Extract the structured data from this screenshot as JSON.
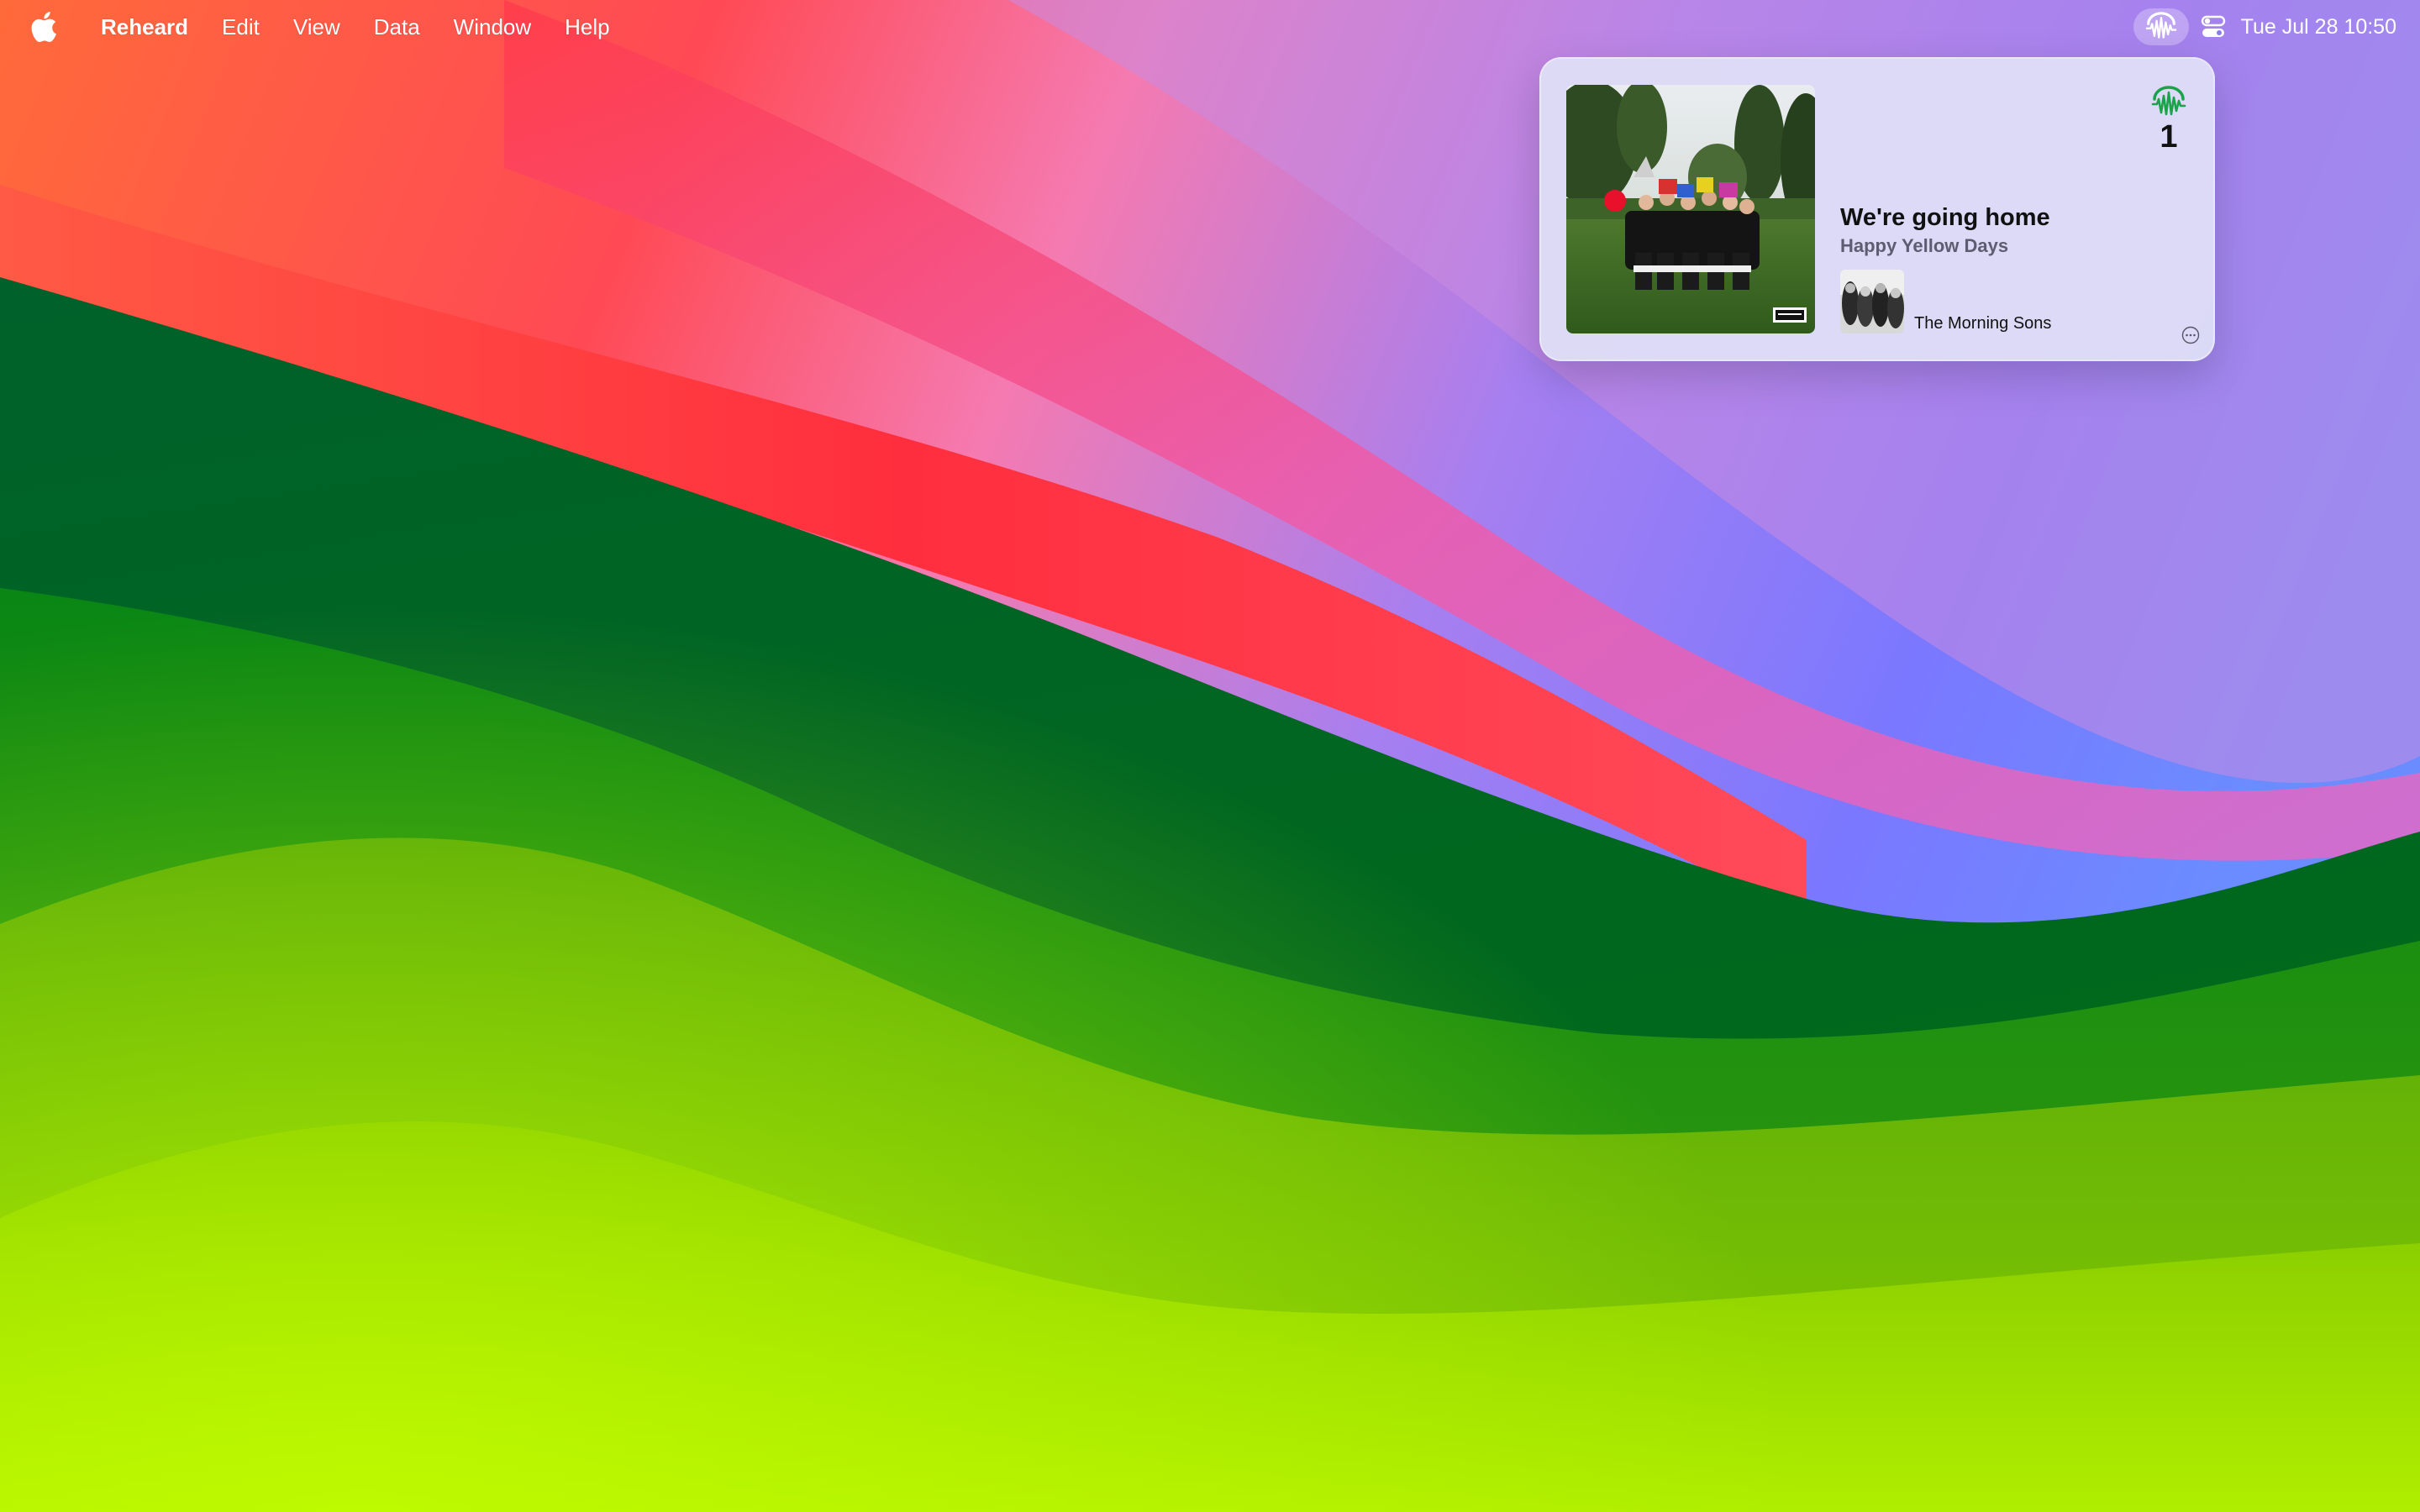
{
  "menubar": {
    "apple_icon": "apple-logo-icon",
    "app_name": "Reheard",
    "items": [
      "Edit",
      "View",
      "Data",
      "Window",
      "Help"
    ],
    "status": {
      "app_icon": "reheard-waveform-icon",
      "control_center_icon": "control-center-icon",
      "clock": "Tue Jul 28  10:50"
    }
  },
  "now_playing": {
    "track_title": "We're going home",
    "album": "Happy Yellow Days",
    "artist": "The Morning Sons",
    "play_count": "1",
    "play_count_icon": "reheard-waveform-icon",
    "more_icon": "ellipsis-circle-icon",
    "album_cover_icon": "album-cover-image",
    "artist_thumb_icon": "artist-photo-image"
  },
  "colors": {
    "popup_bg": "#dedef6",
    "accent_green": "#1aa34a",
    "album_text": "#5d5d72",
    "text": "#111111"
  }
}
